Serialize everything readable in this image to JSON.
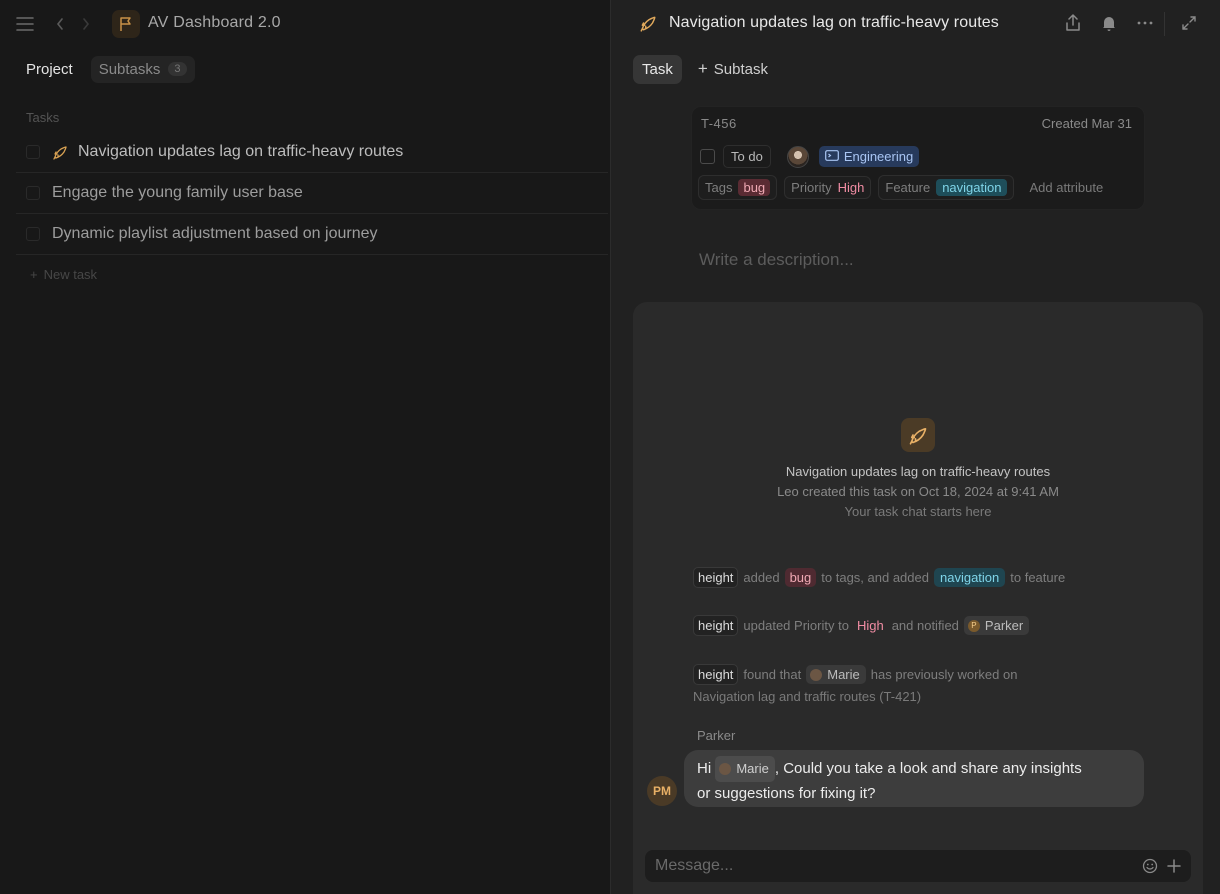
{
  "left": {
    "project_title": "AV Dashboard 2.0",
    "tabs": {
      "project": "Project",
      "subtasks": "Subtasks",
      "subtasks_count": "3"
    },
    "tasks_label": "Tasks",
    "tasks": [
      {
        "title": "Navigation updates lag on traffic-heavy routes",
        "icon": "rocket-icon"
      },
      {
        "title": "Engage the young family user base"
      },
      {
        "title": "Dynamic playlist adjustment based on journey"
      }
    ],
    "new_task": "New task"
  },
  "right": {
    "title": "Navigation updates lag on traffic-heavy routes",
    "tabs": {
      "task": "Task",
      "subtask": "Subtask"
    },
    "card": {
      "id": "T-456",
      "created": "Created Mar 31",
      "status": "To do",
      "team": "Engineering",
      "tags_label": "Tags",
      "tag_value": "bug",
      "priority_label": "Priority",
      "priority_value": "High",
      "feature_label": "Feature",
      "feature_value": "navigation",
      "add_attribute": "Add attribute"
    },
    "description_placeholder": "Write a description...",
    "chat": {
      "intro_title": "Navigation updates lag on traffic-heavy routes",
      "intro_sub": "Leo created this task on Oct 18, 2024  at 9:41 AM",
      "intro_sub2": "Your task chat starts here",
      "activity": [
        {
          "actor": "height",
          "t1": "added",
          "chip1": "bug",
          "t2": "to tags, and added",
          "chip2": "navigation",
          "t3": "to feature"
        },
        {
          "actor": "height",
          "t1": "updated Priority to",
          "chip1": "High",
          "t2": "and notified",
          "person": "Parker",
          "person_initial": "P"
        },
        {
          "actor": "height",
          "t1": "found that",
          "person": "Marie",
          "t2": "has previously worked on",
          "line2": "Navigation lag and traffic routes (T-421)"
        }
      ],
      "message": {
        "sender": "Parker",
        "avatar_initials": "PM",
        "prefix": "Hi",
        "mention": "Marie",
        "text1": ", Could you take a look and share any insights",
        "text2": "or suggestions for fixing it?"
      },
      "composer_placeholder": "Message..."
    }
  },
  "colors": {
    "accent_orange": "#e8b066",
    "bug": "#f0a9b4",
    "navigation": "#7fd4e8",
    "engineering": "#a9c5f3",
    "high": "#f08ca3"
  }
}
